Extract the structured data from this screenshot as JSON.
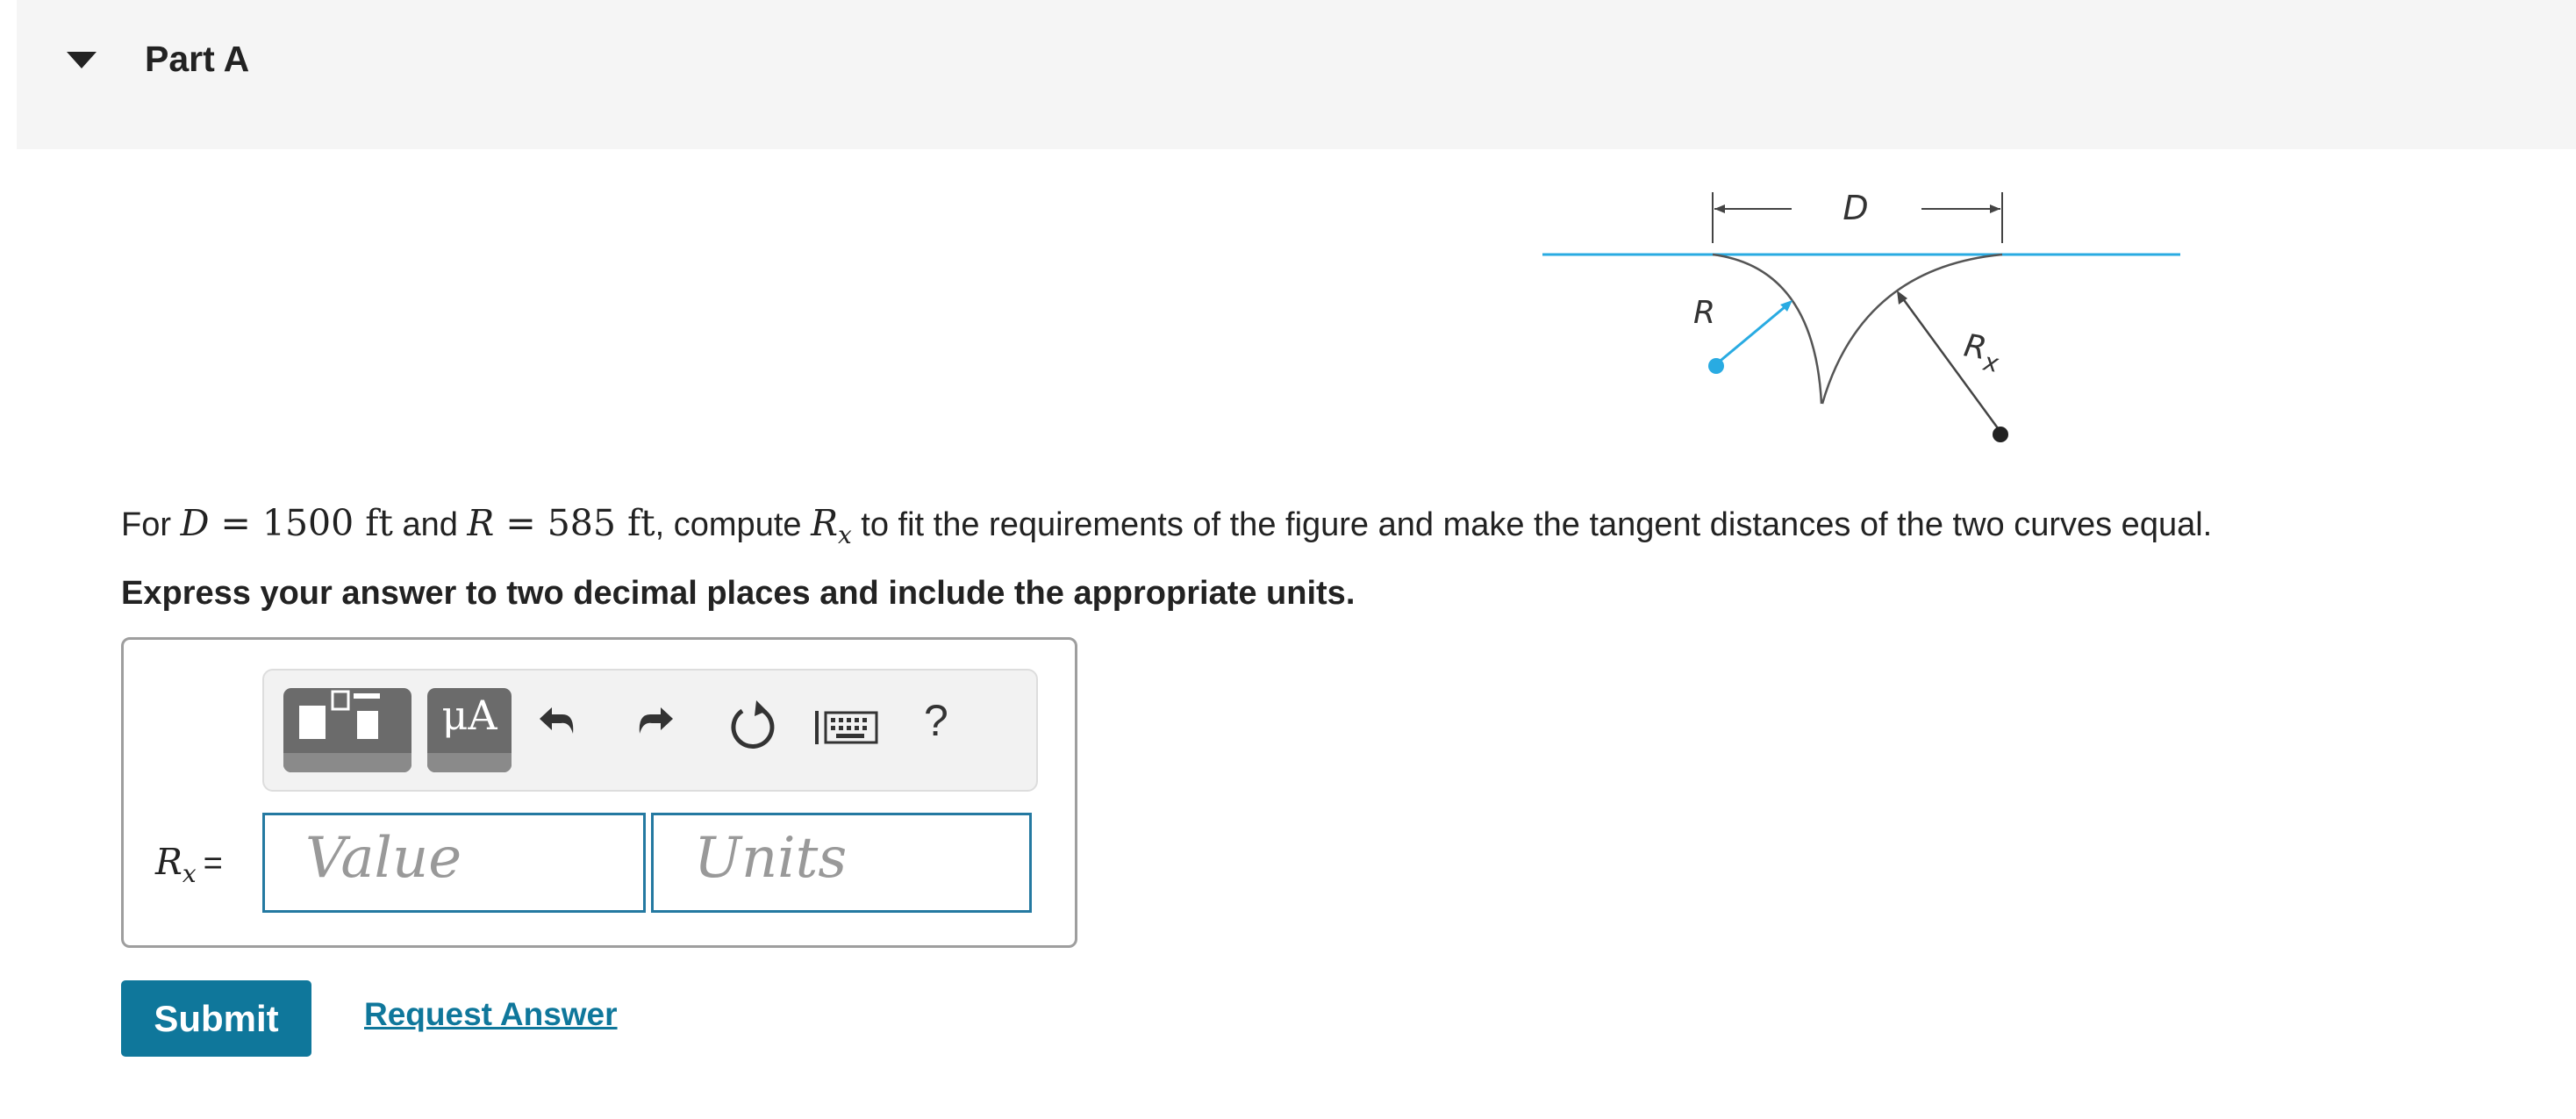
{
  "part": {
    "title": "Part A"
  },
  "figure": {
    "label_D": "D",
    "label_R": "R",
    "label_Rx_base": "R",
    "label_Rx_sub": "x",
    "tangent_color": "#29abe2"
  },
  "question": {
    "prefix": "For ",
    "D_symbol": "D",
    "D_value": " = 1500 ft",
    "and": " and ",
    "R_symbol": "R",
    "R_value": " = 585 ft",
    "compute": ", compute ",
    "Rx_base": "R",
    "Rx_sub": "x",
    "suffix": " to fit the requirements of the figure and make the tangent distances of the two curves equal."
  },
  "instruction": "Express your answer to two decimal places and include the appropriate units.",
  "answer": {
    "label_base": "R",
    "label_sub": "x",
    "label_equals": "=",
    "value_placeholder": "Value",
    "units_placeholder": "Units"
  },
  "toolbar": {
    "units_button_label": "μA",
    "help_label": "?"
  },
  "actions": {
    "submit_label": "Submit",
    "request_answer_label": "Request Answer"
  },
  "colors": {
    "accent": "#0f779b",
    "input_border": "#2479a1"
  }
}
